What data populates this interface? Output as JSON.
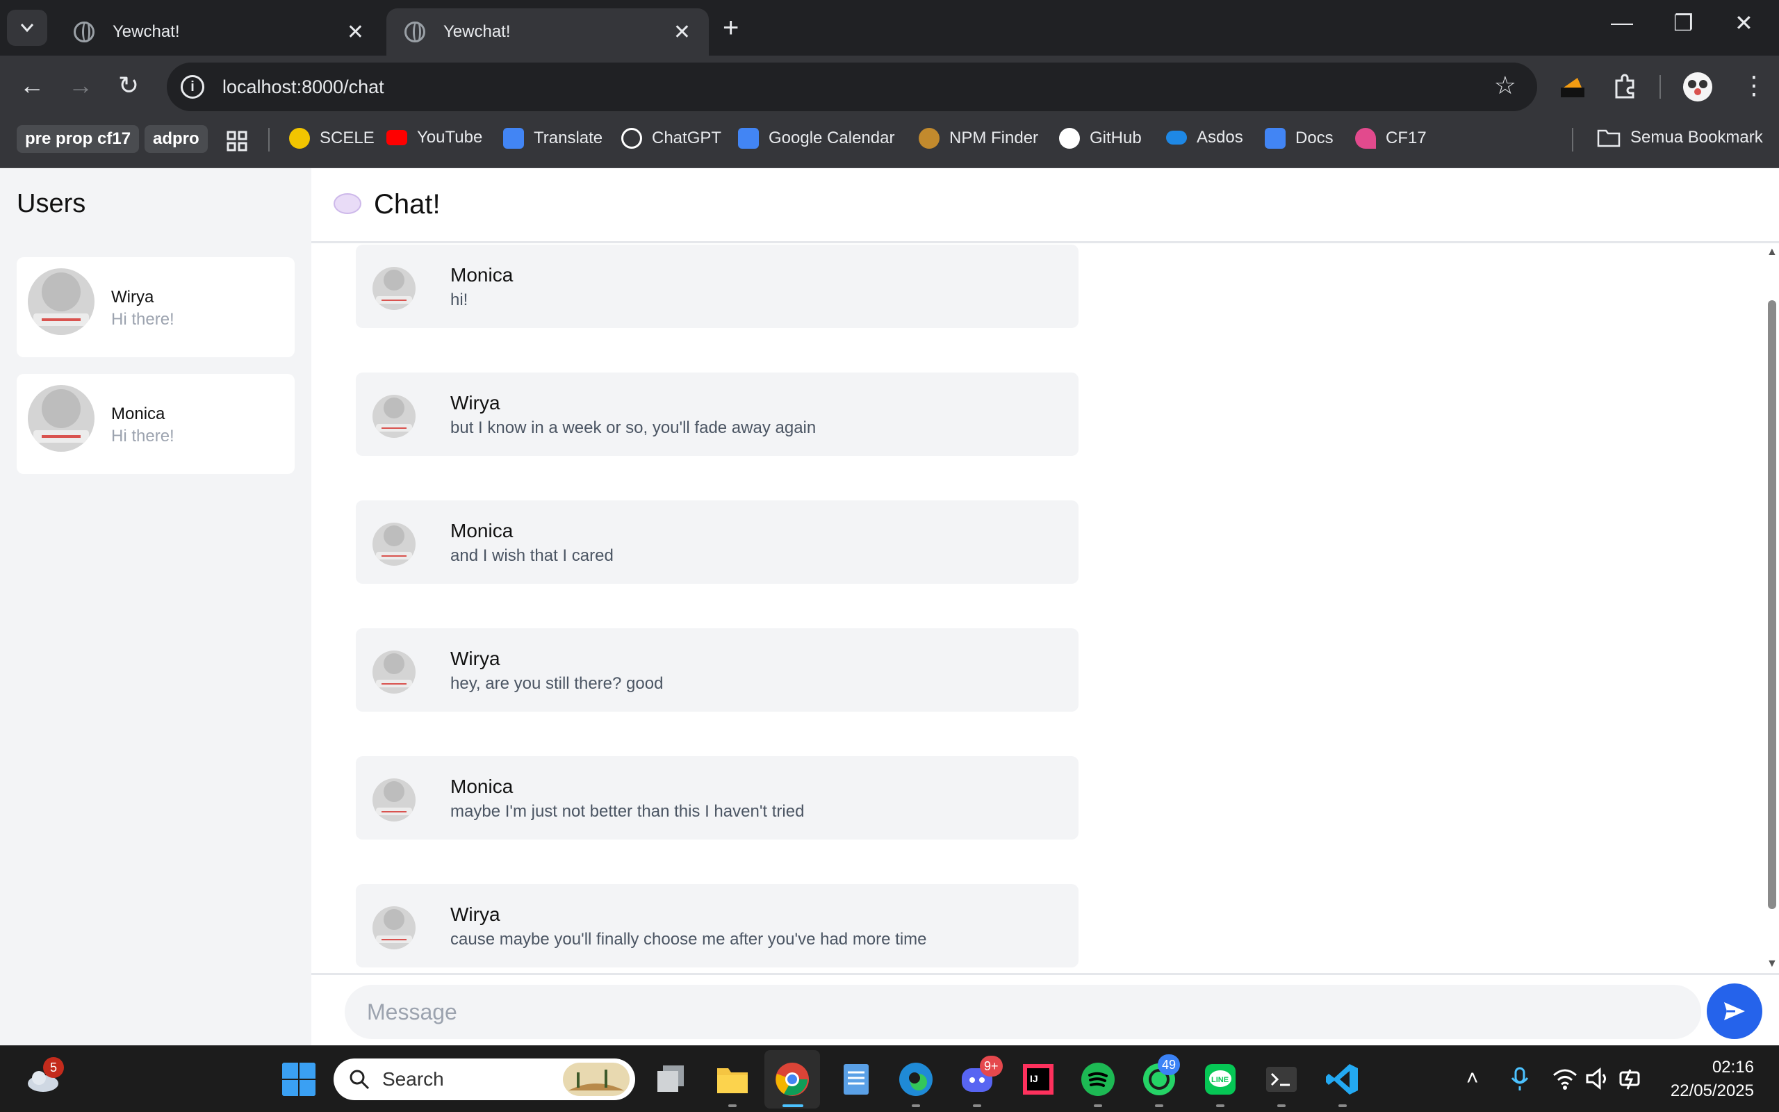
{
  "browser": {
    "tabs": [
      {
        "title": "Yewchat!",
        "active": false
      },
      {
        "title": "Yewchat!",
        "active": true
      }
    ],
    "url": "localhost:8000/chat",
    "bookmarks": {
      "folders": [
        "pre prop cf17",
        "adpro"
      ],
      "items": [
        {
          "label": "SCELE",
          "color": "#f2c500"
        },
        {
          "label": "YouTube",
          "color": "#ff0000"
        },
        {
          "label": "Translate",
          "color": "#4285f4"
        },
        {
          "label": "ChatGPT",
          "color": "#ffffff"
        },
        {
          "label": "Google Calendar",
          "color": "#4285f4"
        },
        {
          "label": "NPM Finder",
          "color": "#c28a2d"
        },
        {
          "label": "GitHub",
          "color": "#ffffff"
        },
        {
          "label": "Asdos",
          "color": "#1e88e5"
        },
        {
          "label": "Docs",
          "color": "#4285f4"
        },
        {
          "label": "CF17",
          "color": "#e24a8d"
        }
      ],
      "all_bookmarks": "Semua Bookmark"
    }
  },
  "app": {
    "sidebar_title": "Users",
    "users": [
      {
        "name": "Wirya",
        "status": "Hi there!"
      },
      {
        "name": "Monica",
        "status": "Hi there!"
      }
    ],
    "chat_title": "Chat!",
    "messages": [
      {
        "author": "Monica",
        "text": "hi!"
      },
      {
        "author": "Wirya",
        "text": "but I know in a week or so, you'll fade away again"
      },
      {
        "author": "Monica",
        "text": "and I wish that I cared"
      },
      {
        "author": "Wirya",
        "text": "hey, are you still there? good"
      },
      {
        "author": "Monica",
        "text": "maybe I'm just not better than this I haven't tried"
      },
      {
        "author": "Wirya",
        "text": "cause maybe you'll finally choose me after you've had more time"
      }
    ],
    "composer_placeholder": "Message",
    "accent": "#2563eb"
  },
  "taskbar": {
    "search_label": "Search",
    "weather_badge": "5",
    "discord_badge": "9+",
    "whatsapp_badge": "49",
    "time": "02:16",
    "date": "22/05/2025"
  }
}
